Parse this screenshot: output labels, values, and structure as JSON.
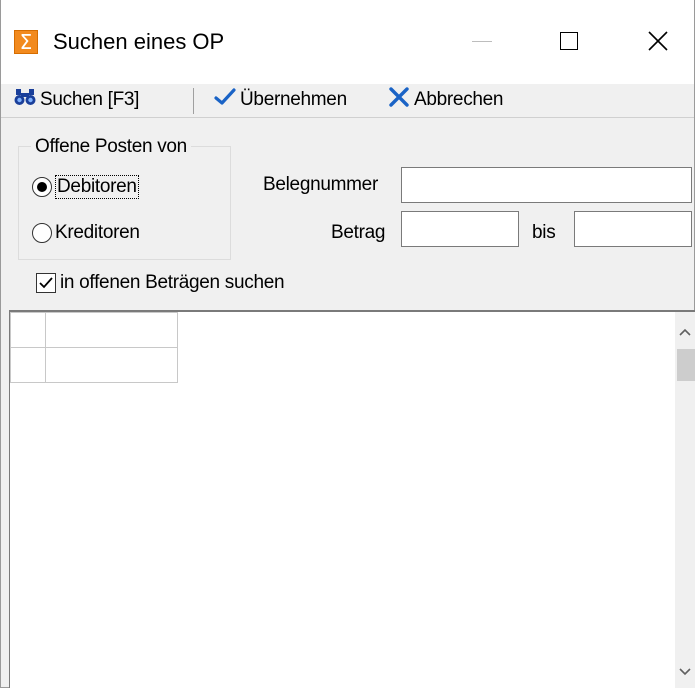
{
  "window": {
    "title": "Suchen eines OP",
    "icon": "sigma-icon",
    "controls": {
      "minimize": "minimize-icon",
      "maximize": "maximize-icon",
      "close": "close-icon"
    }
  },
  "toolbar": {
    "search_label": "Suchen [F3]",
    "accept_label": "Übernehmen",
    "cancel_label": "Abbrechen",
    "icons": {
      "search": "binoculars-icon",
      "accept": "checkmark-icon",
      "cancel": "x-icon"
    },
    "colors": {
      "accept_icon": "#1a63c6",
      "cancel_icon": "#1a63c6",
      "search_icon": "#1a3f9a"
    }
  },
  "filter": {
    "group_title": "Offene Posten von",
    "options": [
      {
        "label": "Debitoren",
        "selected": true
      },
      {
        "label": "Kreditoren",
        "selected": false
      }
    ],
    "belegnummer": {
      "label": "Belegnummer",
      "value": ""
    },
    "betrag": {
      "label": "Betrag",
      "from_value": "",
      "to_label": "bis",
      "to_value": ""
    },
    "open_amounts": {
      "label": "in offenen Beträgen suchen",
      "checked": true
    }
  },
  "results": {
    "rows": [
      [
        "",
        ""
      ],
      [
        "",
        ""
      ]
    ]
  }
}
